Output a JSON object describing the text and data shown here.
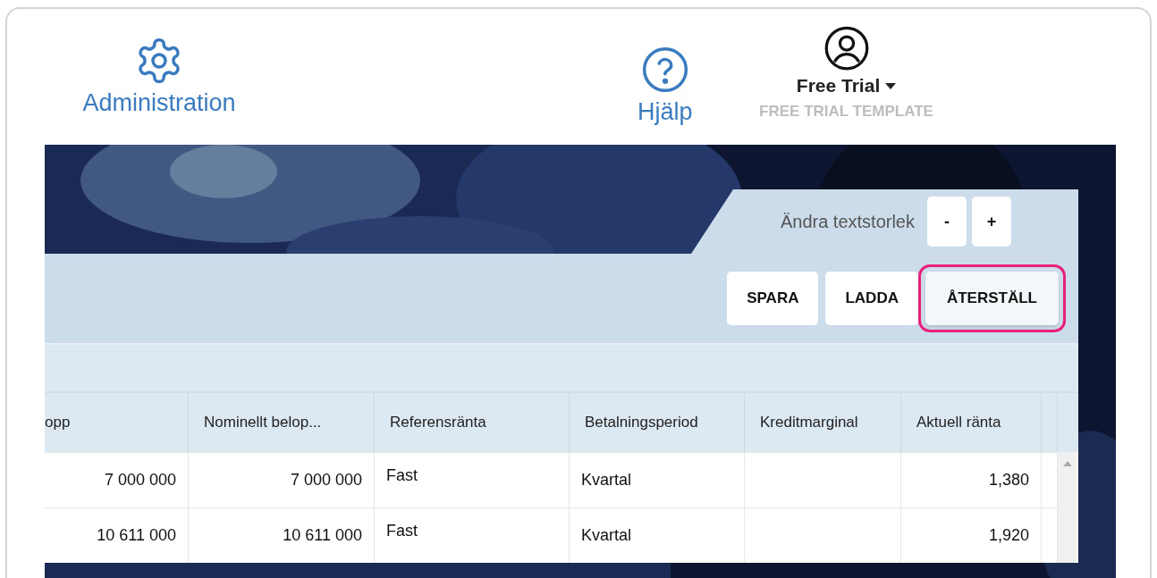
{
  "header": {
    "admin": {
      "label": "Administration"
    },
    "help": {
      "label": "Hjälp"
    },
    "account": {
      "name": "Free Trial",
      "template": "FREE TRIAL TEMPLATE"
    }
  },
  "text_size": {
    "label": "Ändra textstorlek",
    "buttons": [
      "-",
      "+"
    ]
  },
  "actions": [
    {
      "label": "SPARA",
      "highlighted": false
    },
    {
      "label": "LADDA",
      "highlighted": false
    },
    {
      "label": "ÅTERSTÄLL",
      "highlighted": true
    }
  ],
  "table": {
    "columns": [
      {
        "label": "opp"
      },
      {
        "label": "Nominellt belop..."
      },
      {
        "label": "Referensränta"
      },
      {
        "label": "Betalningsperiod"
      },
      {
        "label": "Kreditmarginal"
      },
      {
        "label": "Aktuell ränta"
      }
    ],
    "rows": [
      [
        "7 000 000",
        "7 000 000",
        "Fast",
        "Kvartal",
        "",
        "1,380"
      ],
      [
        "10 611 000",
        "10 611 000",
        "Fast",
        "Kvartal",
        "",
        "1,920"
      ]
    ]
  }
}
